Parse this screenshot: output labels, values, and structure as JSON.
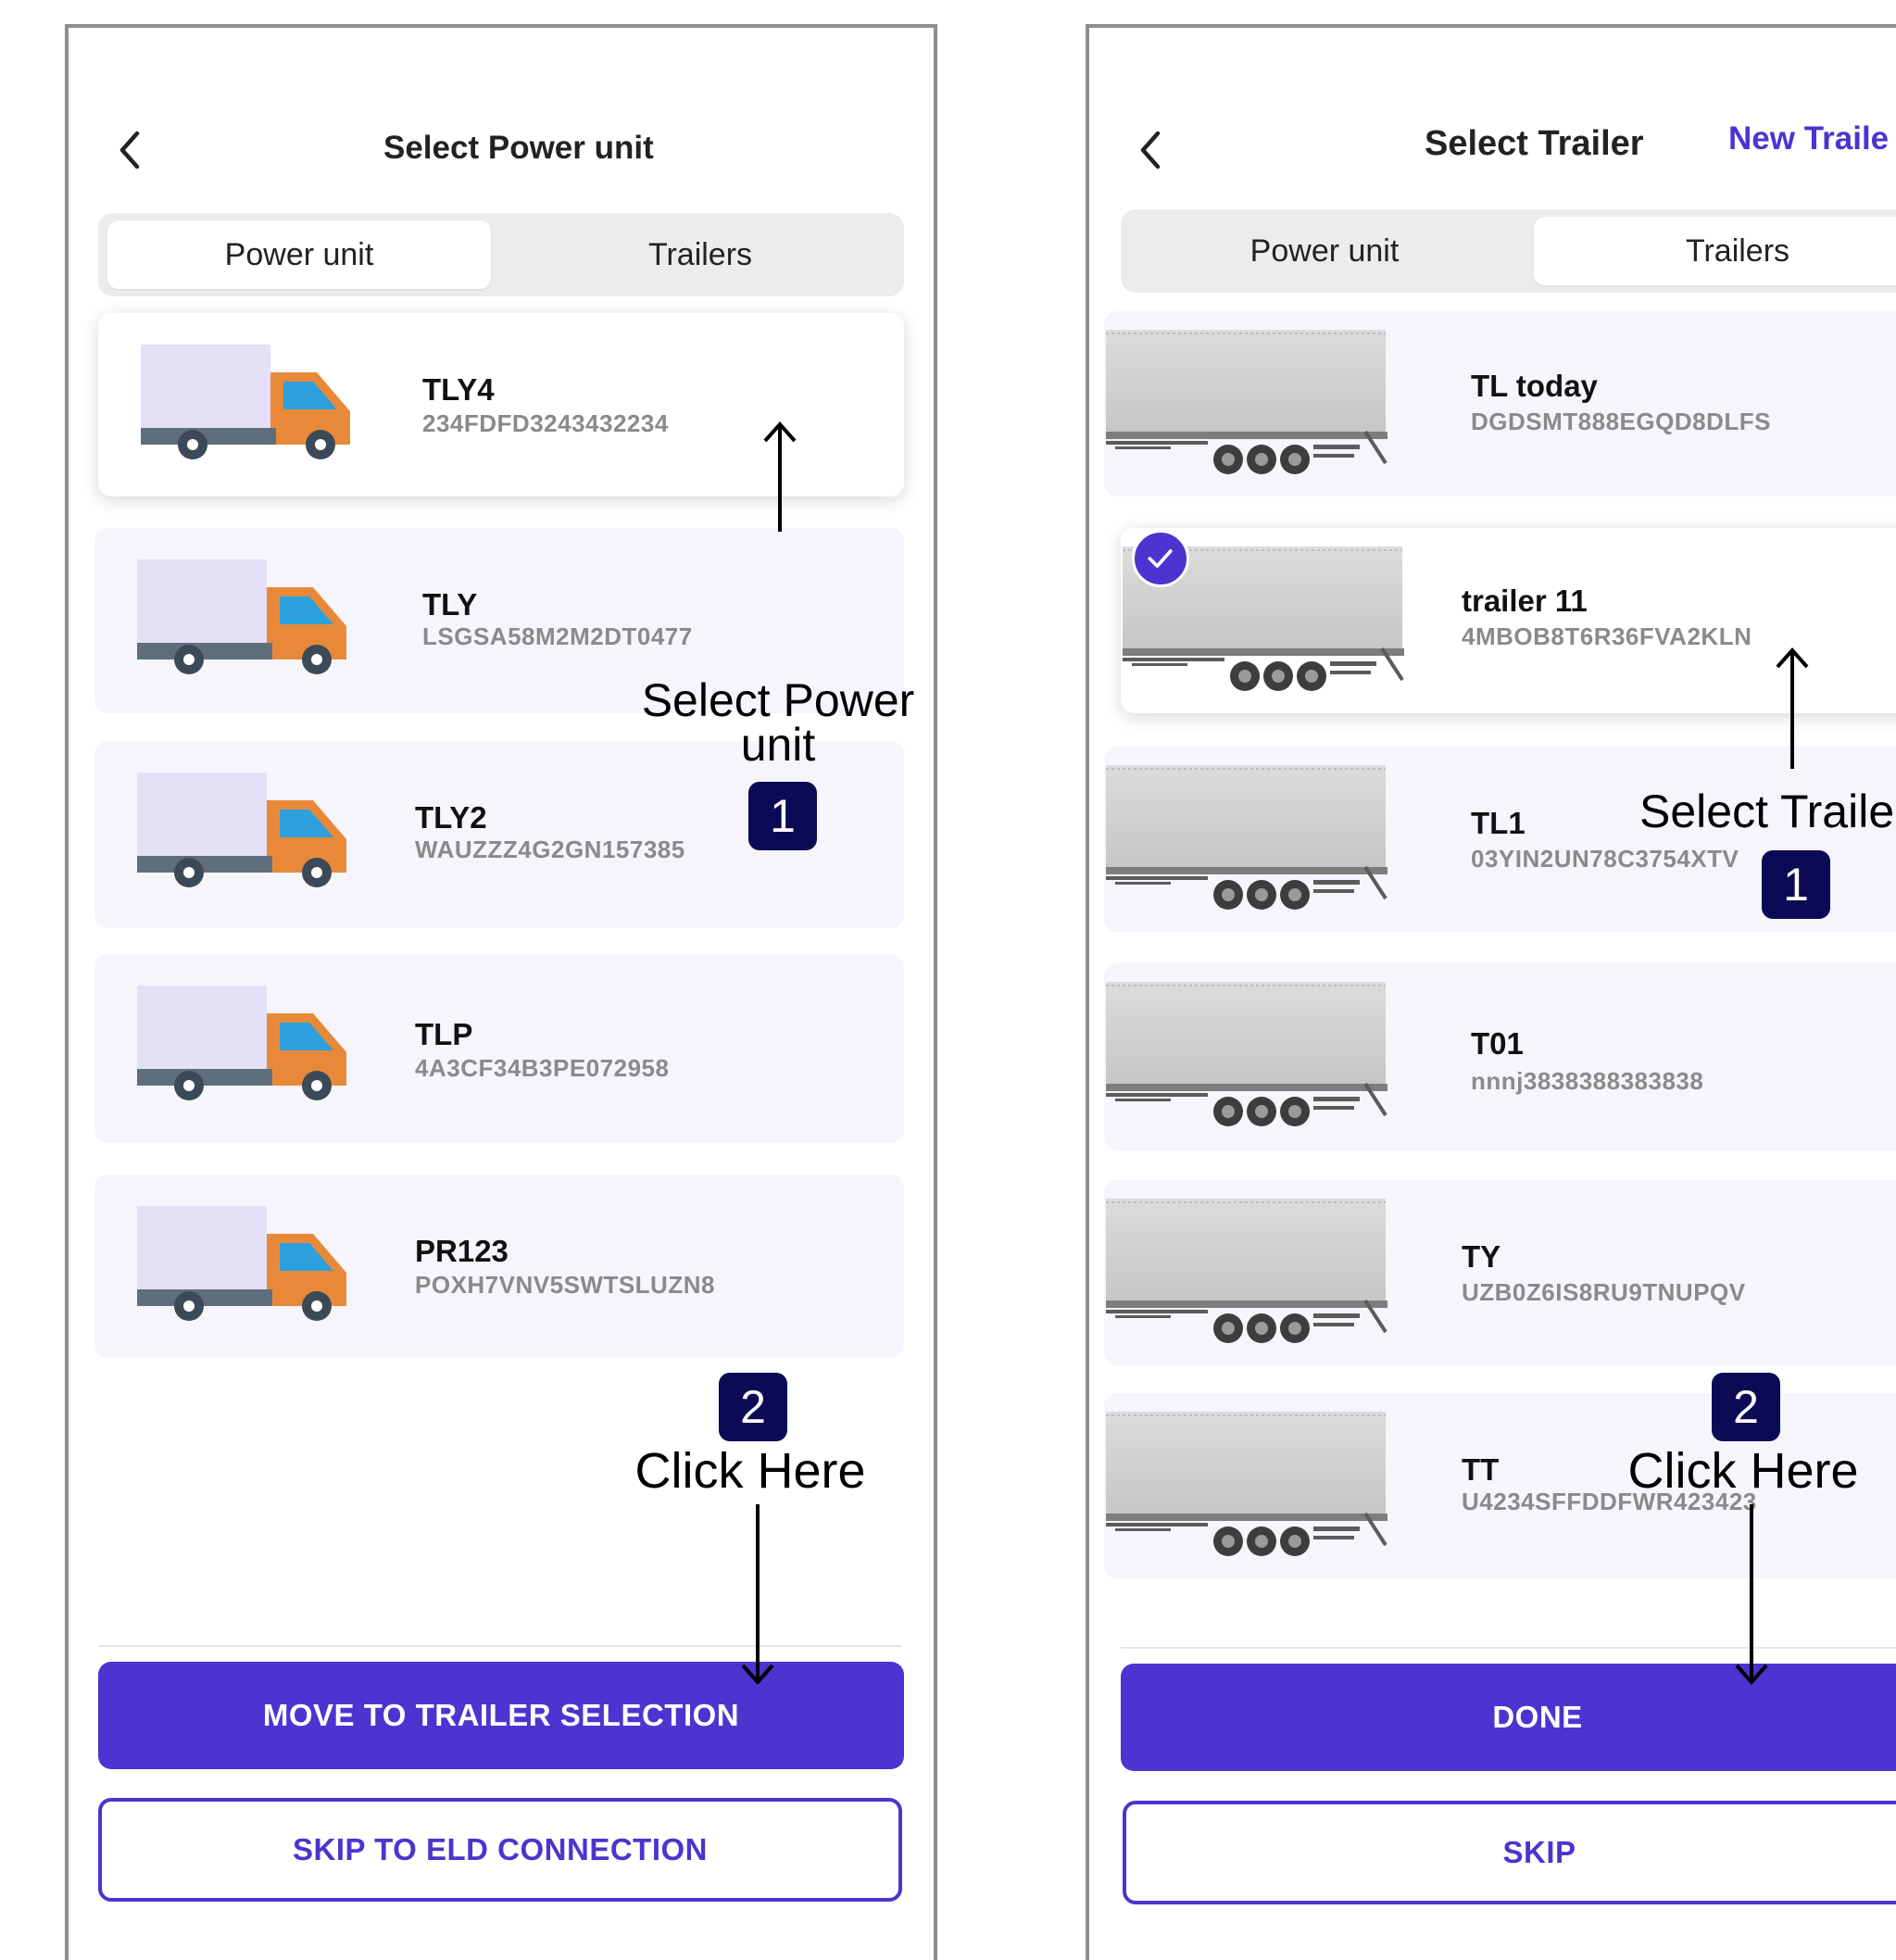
{
  "colors": {
    "accent": "#4b34cf",
    "badge": "#0d0a55",
    "card_bg": "#f5f5fb",
    "truck_body": "#e3e0f7",
    "truck_cab": "#e8893a",
    "truck_window": "#2ca1dd",
    "frame": "#8e8e8e"
  },
  "screen1": {
    "back_icon": "chevron-left-icon",
    "title": "Select Power unit",
    "tabs": [
      {
        "label": "Power unit",
        "active": true
      },
      {
        "label": "Trailers",
        "active": false
      }
    ],
    "items": [
      {
        "name": "TLY4",
        "vin": "234FDFD3243432234",
        "selected": true
      },
      {
        "name": "TLY",
        "vin": "LSGSA58M2M2DT0477",
        "selected": false
      },
      {
        "name": "TLY2",
        "vin": "WAUZZZ4G2GN157385",
        "selected": false
      },
      {
        "name": "TLP",
        "vin": "4A3CF34B3PE072958",
        "selected": false
      },
      {
        "name": "PR123",
        "vin": "POXH7VNV5SWTSLUZN8",
        "selected": false
      }
    ],
    "primary_button": "MOVE TO TRAILER SELECTION",
    "secondary_button": "SKIP TO ELD CONNECTION"
  },
  "screen2": {
    "back_icon": "chevron-left-icon",
    "title": "Select Trailer",
    "new_trailer_link": "New Traile",
    "tabs": [
      {
        "label": "Power unit",
        "active": false
      },
      {
        "label": "Trailers",
        "active": true
      }
    ],
    "items": [
      {
        "name": "TL today",
        "vin": "DGDSMT888EGQD8DLFS",
        "selected": false
      },
      {
        "name": "trailer 11",
        "vin": "4MBOB8T6R36FVA2KLN",
        "selected": true
      },
      {
        "name": "TL1",
        "vin": "03YIN2UN78C3754XTV",
        "selected": false
      },
      {
        "name": "T01",
        "vin": "nnnj3838388383838",
        "selected": false
      },
      {
        "name": "TY",
        "vin": "UZB0Z6IS8RU9TNUPQV",
        "selected": false
      },
      {
        "name": "TT",
        "vin": "U4234SFFDDFWR423423",
        "selected": false
      }
    ],
    "primary_button": "DONE",
    "secondary_button": "SKIP"
  },
  "annotations": {
    "left": {
      "step1_line1": "Select Power",
      "step1_line2": "unit",
      "step1_badge": "1",
      "step2_badge": "2",
      "step2_text": "Click Here"
    },
    "right": {
      "step1_text": "Select Traile",
      "step1_badge": "1",
      "step2_badge": "2",
      "step2_text": "Click Here"
    }
  }
}
